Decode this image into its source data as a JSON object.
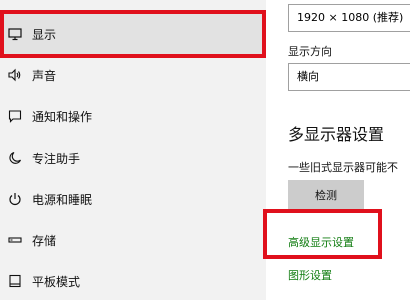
{
  "sidebar": {
    "items": [
      {
        "label": "显示",
        "icon": "monitor-icon"
      },
      {
        "label": "声音",
        "icon": "speaker-icon"
      },
      {
        "label": "通知和操作",
        "icon": "notification-icon"
      },
      {
        "label": "专注助手",
        "icon": "moon-icon"
      },
      {
        "label": "电源和睡眠",
        "icon": "power-icon"
      },
      {
        "label": "存储",
        "icon": "storage-icon"
      },
      {
        "label": "平板模式",
        "icon": "tablet-icon"
      }
    ],
    "selected_index": 0
  },
  "content": {
    "resolution_value": "1920 × 1080 (推荐)",
    "orientation_label": "显示方向",
    "orientation_value": "横向",
    "multi_display_heading": "多显示器设置",
    "multi_display_desc": "一些旧式显示器可能不",
    "detect_button": "检测",
    "advanced_link": "高级显示设置",
    "graphics_link": "图形设置"
  },
  "colors": {
    "accent": "#0078d7",
    "link": "#107c10",
    "highlight": "#e0101c"
  }
}
